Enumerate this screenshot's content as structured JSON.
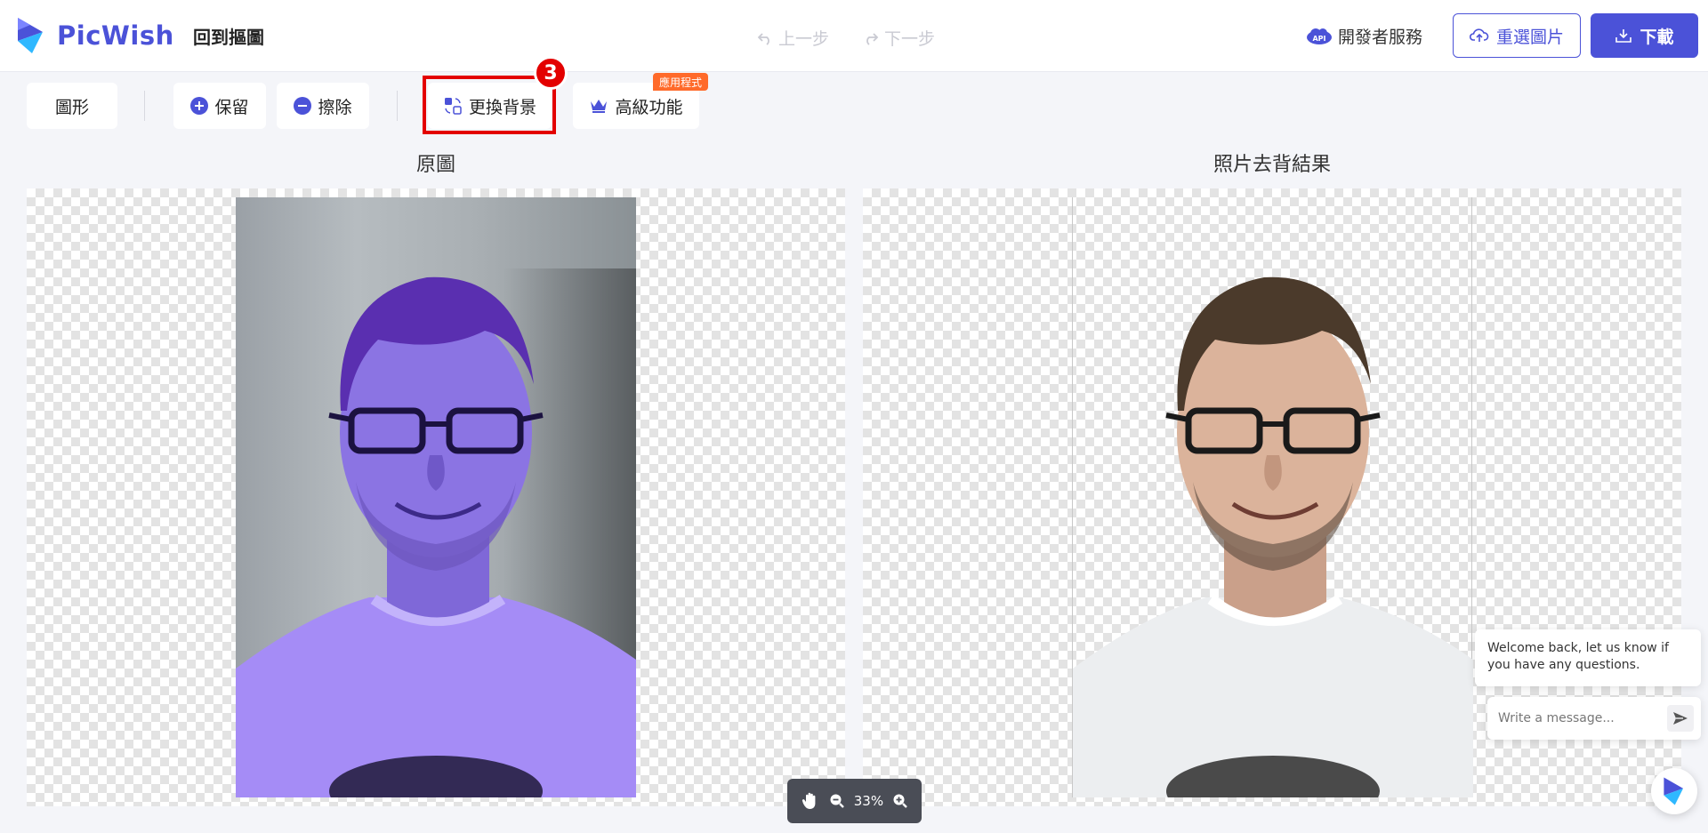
{
  "header": {
    "brand": "PicWish",
    "back_label": "回到摳圖",
    "undo_label": "上一步",
    "redo_label": "下一步",
    "api_label": "開發者服務",
    "api_badge": "API",
    "reselect_label": "重選圖片",
    "download_label": "下載"
  },
  "toolbar": {
    "shape_label": "圖形",
    "keep_label": "保留",
    "erase_label": "擦除",
    "change_bg_label": "更換背景",
    "advanced_label": "高級功能",
    "app_tag": "應用程式",
    "step_number": "3"
  },
  "panels": {
    "original_title": "原圖",
    "result_title": "照片去背結果"
  },
  "zoom": {
    "level": "33%"
  },
  "chat": {
    "welcome": "Welcome back, let us know if you have any questions.",
    "placeholder": "Write a message..."
  },
  "colors": {
    "brand": "#4b52d8",
    "highlight": "#e30000",
    "app_tag": "#ff6a2a"
  }
}
